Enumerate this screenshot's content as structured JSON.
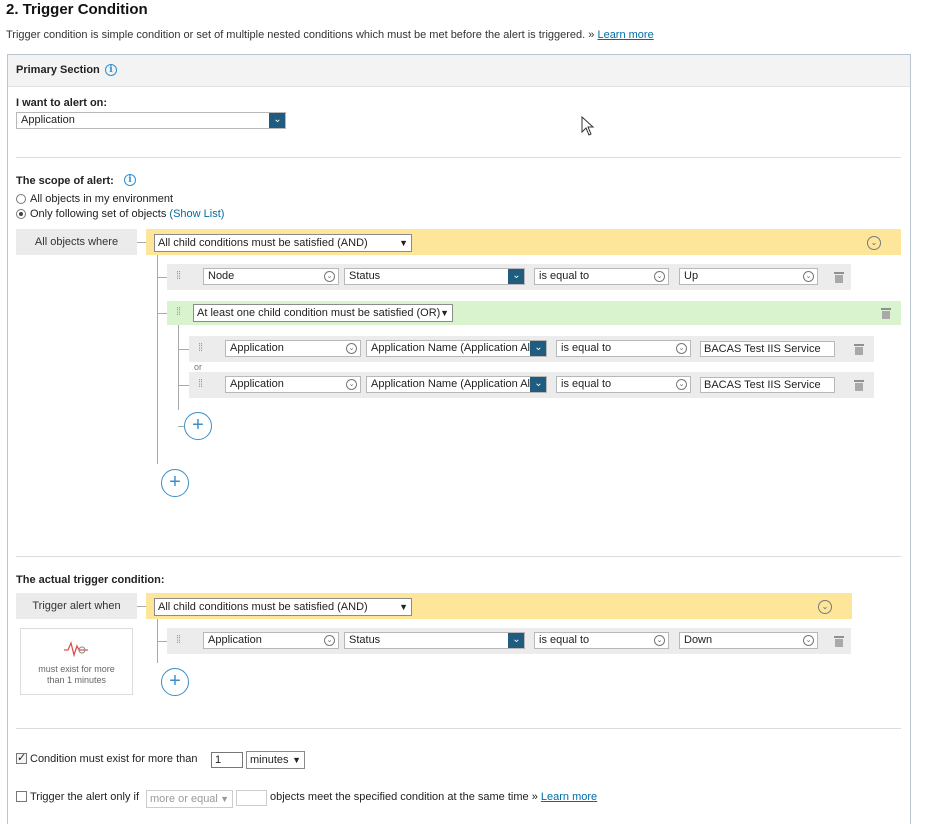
{
  "header": {
    "title": "2. Trigger Condition",
    "description": "Trigger condition is simple condition or set of multiple nested conditions which must be met before the alert is triggered. »",
    "learn_more": "Learn more"
  },
  "primary_section": {
    "title": "Primary Section",
    "alert_on_label": "I want to alert on:",
    "alert_on_value": "Application"
  },
  "scope": {
    "label": "The scope of alert:",
    "options": [
      "All objects in my environment",
      "Only following set of objects"
    ],
    "selected_index": 1,
    "show_list": "(Show List)",
    "where_label": "All objects where",
    "group_operator": "All child conditions must be satisfied (AND)",
    "condition": {
      "object": "Node",
      "field": "Status",
      "operator": "is equal to",
      "value": "Up"
    },
    "or_group": {
      "operator": "At least one child condition must be satisfied (OR)",
      "or_label": "or",
      "conditions": [
        {
          "object": "Application",
          "field": "Application Name (Application Al",
          "operator": "is equal to",
          "value": "BACAS Test IIS Service"
        },
        {
          "object": "Application",
          "field": "Application Name (Application Al",
          "operator": "is equal to",
          "value": "BACAS Test IIS Service"
        }
      ]
    }
  },
  "trigger": {
    "label": "The actual trigger condition:",
    "when_label": "Trigger alert when",
    "group_operator": "All child conditions must be satisfied (AND)",
    "condition": {
      "object": "Application",
      "field": "Status",
      "operator": "is equal to",
      "value": "Down"
    },
    "exist_note": "must exist for more than 1 minutes"
  },
  "footer": {
    "condition_exist_checked": true,
    "condition_exist_label": "Condition must exist for more than",
    "minutes_value": "1",
    "minutes_unit": "minutes",
    "trigger_only_checked": false,
    "trigger_only_label": "Trigger the alert only if",
    "more_or_equal": "more or equal",
    "objects_meet": "objects meet the specified condition at the same time »",
    "learn_more": "Learn more"
  },
  "icons": {
    "info": "info-icon",
    "drag": "drag-handle-icon",
    "trash": "trash-icon",
    "plus": "plus-icon",
    "collapse": "chevron-down-circle-icon",
    "pulse": "pulse-icon"
  },
  "colors": {
    "and_bar": "#fde59a",
    "or_bar": "#d9f3cf",
    "dropdown_dark": "#1f5c7f",
    "link": "#006ba6",
    "add_button": "#3b8fc7"
  }
}
